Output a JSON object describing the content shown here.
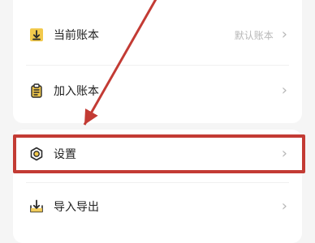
{
  "settings_list": {
    "items": [
      {
        "label": "当前账本",
        "value": "默认账本",
        "icon": "ledger-download-icon"
      },
      {
        "label": "加入账本",
        "value": "",
        "icon": "clipboard-icon"
      },
      {
        "label": "设置",
        "value": "",
        "icon": "settings-gear-icon"
      },
      {
        "label": "导入导出",
        "value": "",
        "icon": "import-export-icon"
      }
    ]
  },
  "annotations": {
    "highlight_color": "#c33b34",
    "arrow_color": "#c33b34",
    "highlighted_item": "设置"
  },
  "colors": {
    "accent_yellow": "#f2c94c",
    "text_primary": "#222222",
    "text_secondary": "#b7b7b7"
  }
}
